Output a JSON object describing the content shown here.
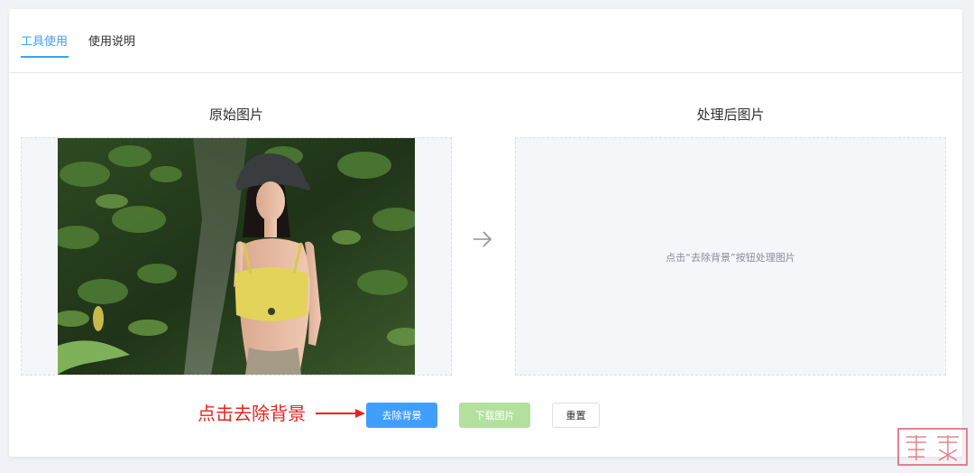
{
  "tabs": [
    {
      "label": "工具使用",
      "active": true
    },
    {
      "label": "使用说明",
      "active": false
    }
  ],
  "original": {
    "title": "原始图片"
  },
  "processed": {
    "title": "处理后图片",
    "placeholder": "点击“去除背景”按钮处理图片"
  },
  "buttons": {
    "remove_bg": "去除背景",
    "download": "下载图片",
    "reset": "重置"
  },
  "annotation": {
    "text": "点击去除背景"
  },
  "colors": {
    "accent": "#409eff",
    "download_disabled": "#b3e19d",
    "annotation_red": "#e8231e"
  },
  "icons": {
    "arrow": "arrow-right-icon",
    "annotation_arrow": "arrow-right-icon"
  }
}
